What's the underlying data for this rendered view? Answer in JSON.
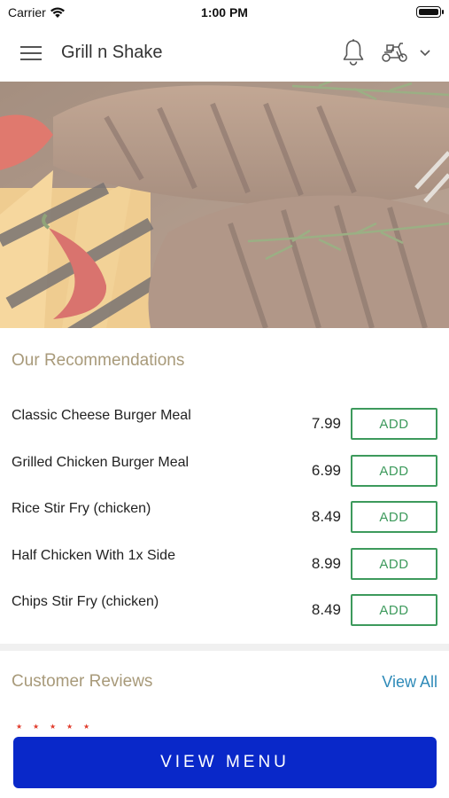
{
  "status_bar": {
    "carrier": "Carrier",
    "time": "1:00 PM"
  },
  "header": {
    "title": "Grill n Shake"
  },
  "recommendations": {
    "title": "Our Recommendations",
    "items": [
      {
        "name": "Classic Cheese Burger Meal",
        "price": "7.99",
        "action": "ADD"
      },
      {
        "name": "Grilled Chicken Burger Meal",
        "price": "6.99",
        "action": "ADD"
      },
      {
        "name": "Rice Stir Fry (chicken)",
        "price": "8.49",
        "action": "ADD"
      },
      {
        "name": "Half Chicken With 1x Side",
        "price": "8.99",
        "action": "ADD"
      },
      {
        "name": "Chips Stir Fry (chicken)",
        "price": "8.49",
        "action": "ADD"
      }
    ]
  },
  "reviews": {
    "title": "Customer Reviews",
    "view_all": "View All"
  },
  "footer": {
    "view_menu": "VIEW MENU"
  },
  "colors": {
    "accent_text": "#a89a7a",
    "add_green": "#3d9a5c",
    "link_blue": "#2e8ab8",
    "cta_blue": "#0928c9",
    "star_red": "#e03a2a"
  }
}
